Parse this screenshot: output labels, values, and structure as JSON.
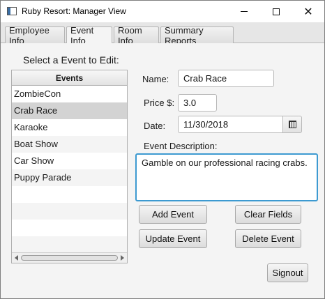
{
  "window": {
    "title": "Ruby Resort: Manager View"
  },
  "tabs": [
    {
      "label": "Employee Info"
    },
    {
      "label": "Event Info"
    },
    {
      "label": "Room Info"
    },
    {
      "label": "Summary Reports"
    }
  ],
  "active_tab": "Event Info",
  "event_list": {
    "prompt": "Select a Event to Edit:",
    "header": "Events",
    "items": [
      "ZombieCon",
      "Crab Race",
      "Karaoke",
      "Boat Show",
      "Car Show",
      "Puppy Parade"
    ],
    "selected": "Crab Race"
  },
  "form": {
    "name_label": "Name:",
    "name_value": "Crab Race",
    "price_label": "Price $:",
    "price_value": "3.0",
    "date_label": "Date:",
    "date_value": "11/30/2018",
    "description_label": "Event Description:",
    "description_value": "Gamble on our professional racing crabs."
  },
  "buttons": {
    "add": "Add Event",
    "clear": "Clear Fields",
    "update": "Update Event",
    "delete": "Delete Event",
    "signout": "Signout"
  },
  "icons": {
    "app": "app-window-icon",
    "minimize": "minimize-icon",
    "maximize": "maximize-icon",
    "close": "close-icon",
    "calendar": "calendar-icon"
  },
  "colors": {
    "focus_border": "#3d9ad1",
    "selected_row": "#d3d3d3"
  }
}
